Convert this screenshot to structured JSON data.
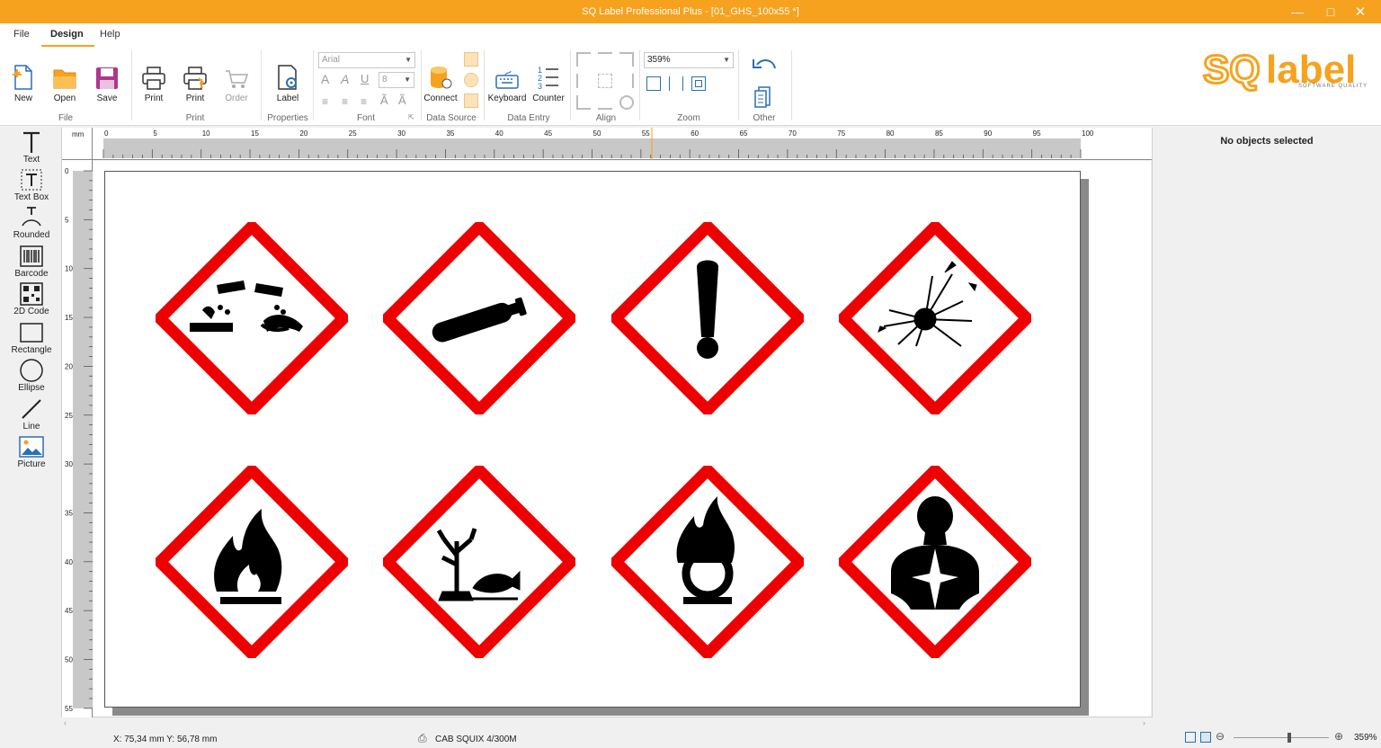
{
  "window": {
    "title": "SQ Label Professional Plus - [01_GHS_100x55 *]",
    "controls": [
      "minimize",
      "maximize",
      "close"
    ]
  },
  "menu": {
    "tabs": [
      {
        "label": "File"
      },
      {
        "label": "Design",
        "active": true
      },
      {
        "label": "Help"
      }
    ]
  },
  "ribbon": {
    "file": {
      "group": "File",
      "new": "New",
      "open": "Open",
      "save": "Save"
    },
    "print": {
      "group": "Print",
      "print1": "Print",
      "print2": "Print",
      "order": "Order"
    },
    "properties": {
      "group": "Properties",
      "label": "Label"
    },
    "font": {
      "group": "Font",
      "family": "Arial",
      "size": "8"
    },
    "data_source": {
      "group": "Data Source",
      "connect": "Connect"
    },
    "data_entry": {
      "group": "Data Entry",
      "keyboard": "Keyboard",
      "counter": "Counter"
    },
    "align": {
      "group": "Align"
    },
    "zoom": {
      "group": "Zoom",
      "value": "359%"
    },
    "other": {
      "group": "Other"
    }
  },
  "brand": {
    "logo_text": "SQ label",
    "tagline": "SOFTWARE QUALITY",
    "accent_color": "#f6a21e"
  },
  "toolbox": {
    "items": [
      {
        "label": "Text",
        "icon": "text-icon"
      },
      {
        "label": "Text Box",
        "icon": "textbox-icon"
      },
      {
        "label": "Rounded",
        "icon": "rounded-text-icon"
      },
      {
        "label": "Barcode",
        "icon": "barcode-icon"
      },
      {
        "label": "2D Code",
        "icon": "qr-code-icon"
      },
      {
        "label": "Rectangle",
        "icon": "rectangle-icon"
      },
      {
        "label": "Ellipse",
        "icon": "ellipse-icon"
      },
      {
        "label": "Line",
        "icon": "line-icon"
      },
      {
        "label": "Picture",
        "icon": "picture-icon"
      }
    ]
  },
  "rulers": {
    "unit": "mm",
    "top_ticks": [
      "0",
      "5",
      "10",
      "15",
      "20",
      "25",
      "30",
      "35",
      "40",
      "45",
      "50",
      "55",
      "60",
      "65",
      "70",
      "75",
      "80",
      "85",
      "90",
      "95",
      "100"
    ],
    "left_ticks": [
      "0",
      "5",
      "10",
      "15",
      "20",
      "25",
      "30",
      "35",
      "40",
      "45",
      "50",
      "55"
    ]
  },
  "label_content": {
    "pictograms": [
      {
        "name": "corrosive-pictogram"
      },
      {
        "name": "gas-cylinder-pictogram"
      },
      {
        "name": "exclamation-pictogram"
      },
      {
        "name": "explosive-pictogram"
      },
      {
        "name": "flammable-pictogram"
      },
      {
        "name": "environment-pictogram"
      },
      {
        "name": "oxidizer-pictogram"
      },
      {
        "name": "health-hazard-pictogram"
      }
    ],
    "diamond_color": "#ee0000"
  },
  "properties_pane": {
    "message": "No objects selected"
  },
  "status": {
    "coordinates": "X: 75,34 mm Y: 56,78 mm",
    "printer": "CAB SQUIX 4/300M",
    "zoom": "359%"
  }
}
